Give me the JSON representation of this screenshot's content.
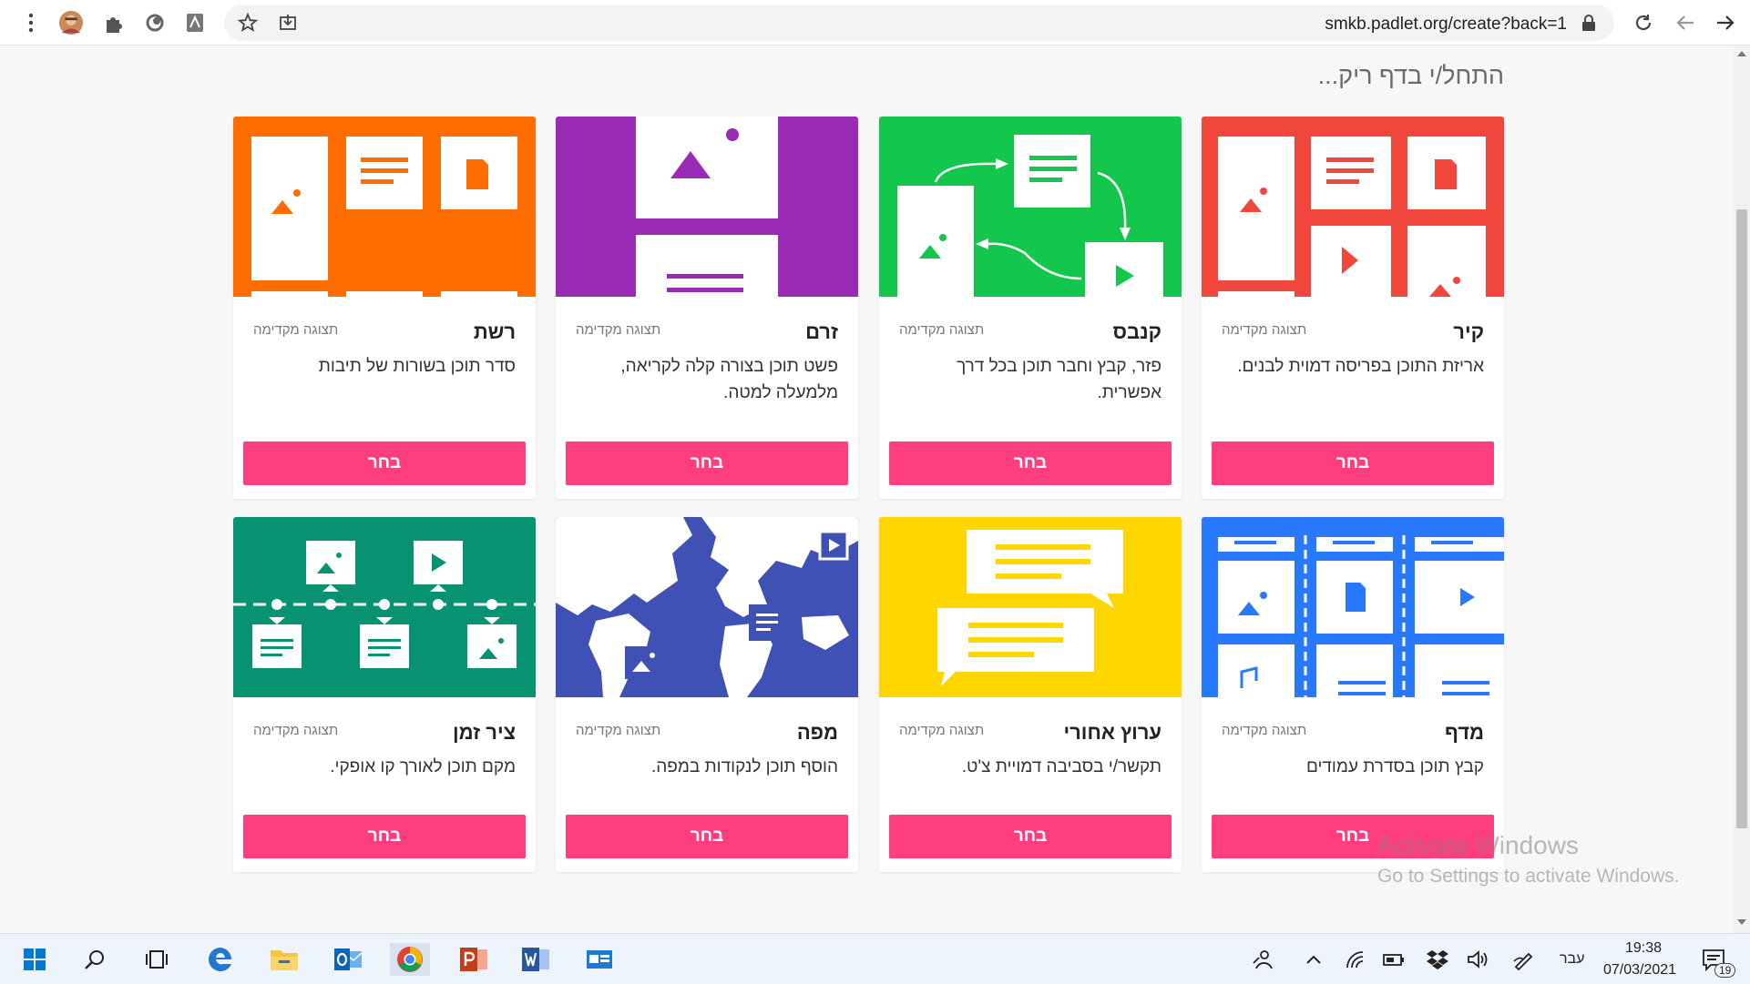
{
  "browser": {
    "url": "smkb.padlet.org/create?back=1"
  },
  "page": {
    "heading": "התחל/י בדף ריק..."
  },
  "cards": [
    {
      "title": "קיר",
      "preview": "תצוגה מקדימה",
      "description": "אריזת התוכן בפריסה דמוית לבנים.",
      "button": "בחר",
      "color": "#f0463c"
    },
    {
      "title": "קנבס",
      "preview": "תצוגה מקדימה",
      "description": "פזר, קבץ וחבר תוכן בכל דרך אפשרית.",
      "button": "בחר",
      "color": "#12c74b"
    },
    {
      "title": "זרם",
      "preview": "תצוגה מקדימה",
      "description": "פשט תוכן בצורה קלה לקריאה, מלמעלה למטה.",
      "button": "בחר",
      "color": "#9a2bb5"
    },
    {
      "title": "רשת",
      "preview": "תצוגה מקדימה",
      "description": "סדר תוכן בשורות של תיבות",
      "button": "בחר",
      "color": "#ff6d00"
    },
    {
      "title": "מדף",
      "preview": "תצוגה מקדימה",
      "description": "קבץ תוכן בסדרת עמודים",
      "button": "בחר",
      "color": "#2979ff"
    },
    {
      "title": "ערוץ אחורי",
      "preview": "תצוגה מקדימה",
      "description": "תקשר/י בסביבה דמויית צ'ט.",
      "button": "בחר",
      "color": "#ffd600"
    },
    {
      "title": "מפה",
      "preview": "תצוגה מקדימה",
      "description": "הוסף תוכן לנקודות במפה.",
      "button": "בחר",
      "color": "#3f51b5"
    },
    {
      "title": "ציר זמן",
      "preview": "תצוגה מקדימה",
      "description": "מקם תוכן לאורך קו אופקי.",
      "button": "בחר",
      "color": "#079272"
    }
  ],
  "watermark": {
    "title": "Activate Windows",
    "subtitle": "Go to Settings to activate Windows."
  },
  "taskbar": {
    "language": "עבר",
    "time": "19:38",
    "date": "07/03/2021",
    "notifications": "19"
  }
}
